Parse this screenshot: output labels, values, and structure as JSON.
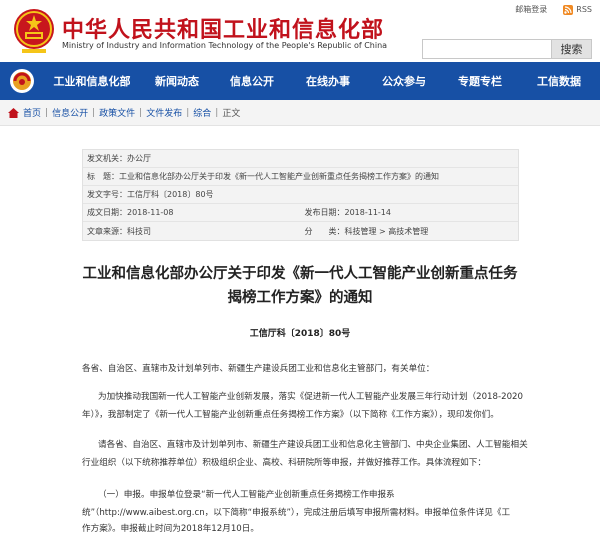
{
  "header": {
    "title": "中华人民共和国工业和信息化部",
    "subtitle": "Ministry of Industry and Information Technology of the People's Republic of China",
    "mail_login": "邮箱登录",
    "rss": "RSS",
    "search_placeholder": "",
    "search_button": "搜索"
  },
  "nav": {
    "items": [
      "工业和信息化部",
      "新闻动态",
      "信息公开",
      "在线办事",
      "公众参与",
      "专题专栏",
      "工信数据"
    ]
  },
  "breadcrumb": [
    "首页",
    "信息公开",
    "政策文件",
    "文件发布",
    "综合",
    "正文"
  ],
  "meta": {
    "issuer": "发文机关：办公厅",
    "title_label": "标　题：",
    "title_value": "工业和信息化部办公厅关于印发《新一代人工智能产业创新重点任务揭榜工作方案》的通知",
    "doc_no": "发文字号：工信厅科〔2018〕80号",
    "created": "成文日期：2018-11-08",
    "published": "发布日期：2018-11-14",
    "source": "文章来源：科技司",
    "category": "分　　类：科技管理 > 高技术管理"
  },
  "document": {
    "title_line1": "工业和信息化部办公厅关于印发《新一代人工智能产业创新重点任务",
    "title_line2": "揭榜工作方案》的通知",
    "number": "工信厅科〔2018〕80号",
    "salutation": "各省、自治区、直辖市及计划单列市、新疆生产建设兵团工业和信息化主管部门，有关单位：",
    "para1_line1": "为加快推动我国新一代人工智能产业创新发展，落实《促进新一代人工智能产业发展三年行动计划（2018-2020",
    "para1_line2": "年）》，我部制定了《新一代人工智能产业创新重点任务揭榜工作方案》（以下简称《工作方案》），现印发你们。",
    "para2_line1": "请各省、自治区、直辖市及计划单列市、新疆生产建设兵团工业和信息化主管部门、中央企业集团、人工智能相关",
    "para2_line2": "行业组织（以下统称推荐单位）积极组织企业、高校、科研院所等申报，并做好推荐工作。具体流程如下：",
    "para3_line1": "（一）申报。申报单位登录“新一代人工智能产业创新重点任务揭榜工作申报系",
    "para3_line2": "统”（http://www.aibest.org.cn，以下简称“申报系统”），完成注册后填写申报所需材料。申报单位条件详见《工",
    "para3_line3": "作方案》。申报截止时间为2018年12月10日。"
  },
  "colors": {
    "brand_red": "#c1121c",
    "nav_blue": "#1750a5"
  }
}
